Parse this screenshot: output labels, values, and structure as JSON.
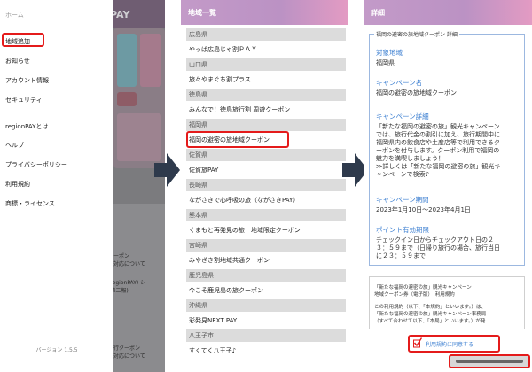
{
  "panel1": {
    "home": "ホーム",
    "menu_top": [
      "地域追加",
      "お知らせ",
      "アカウント情報",
      "セキュリティ"
    ],
    "menu_bottom": [
      "regionPAYとは",
      "ヘルプ",
      "プライバシーポリシー",
      "利用規約",
      "商標・ライセンス"
    ],
    "version": "バージョン 1.5.5",
    "bg_header": "PAY",
    "bg_lines": [
      "クーポン",
      "の対応について",
      "(regionPAY) シ",
      "(第二報)",
      "旅行クーポン",
      "の対応について"
    ]
  },
  "panel2": {
    "title": "地域一覧",
    "rows": [
      {
        "text": "広島県",
        "kind": "pref"
      },
      {
        "text": "やっぱ広島じゃ割ＰＡＹ",
        "kind": "city"
      },
      {
        "text": "山口県",
        "kind": "pref"
      },
      {
        "text": "旅々やまぐち割プラス",
        "kind": "city"
      },
      {
        "text": "徳島県",
        "kind": "pref"
      },
      {
        "text": "みんなで！徳島旅行割 周遊クーポン",
        "kind": "city"
      },
      {
        "text": "福岡県",
        "kind": "pref"
      },
      {
        "text": "福岡の避密の旅地域クーポン",
        "kind": "city"
      },
      {
        "text": "佐賀県",
        "kind": "pref"
      },
      {
        "text": "佐賀旅PAY",
        "kind": "city"
      },
      {
        "text": "長崎県",
        "kind": "pref"
      },
      {
        "text": "ながさきで心呼吸の旅（ながさきPAY）",
        "kind": "city"
      },
      {
        "text": "熊本県",
        "kind": "pref"
      },
      {
        "text": "くまもと再発見の旅　地域限定クーポン",
        "kind": "city"
      },
      {
        "text": "宮崎県",
        "kind": "pref"
      },
      {
        "text": "みやざき割地域共通クーポン",
        "kind": "city"
      },
      {
        "text": "鹿児島県",
        "kind": "pref"
      },
      {
        "text": "今こそ鹿児島の旅クーポン",
        "kind": "city"
      },
      {
        "text": "沖縄県",
        "kind": "pref"
      },
      {
        "text": "彩発見NEXT PAY",
        "kind": "city"
      },
      {
        "text": "八王子市",
        "kind": "pref"
      },
      {
        "text": "すくてく八王子♪",
        "kind": "city"
      }
    ]
  },
  "panel3": {
    "title": "詳細",
    "box_title": "福岡の避密の旅地域クーポン 詳細",
    "target_label": "対象地域",
    "target_value": "福岡県",
    "campaign_label": "キャンペーン名",
    "campaign_value": "福岡の避密の旅地域クーポン",
    "detail_label": "キャンペーン詳細",
    "detail_lines": [
      "「新たな福岡の避密の旅」観光キャンペーン",
      "では、旅行代金の割引に加え、旅行期間中に",
      "福岡県内の飲食店や土産店等で利用できるク",
      "ーポンを付与します。クーポン利用で福岡の",
      "魅力を満喫しましょう！",
      "≫詳しくは「新たな福岡の避密の旅」観光キ",
      "ャンペーンで検索♪"
    ],
    "period_label": "キャンペーン期間",
    "period_value": "2023年1月10日〜2023年4月1日",
    "expiry_label": "ポイント有効期限",
    "expiry_lines": [
      "チェックイン日からチェックアウト日の２",
      "３：５９まで（日帰り旅行の場合、旅行当日",
      "に２３：５９まで"
    ],
    "terms_lines": [
      "「新たな福岡の避密の旅」観光キャンペーン",
      "地域クーポン券（電子版）　利用規約",
      "この利用規約（以下、「本規約」といいます。）は、",
      "「新たな福岡の避密の旅」観光キャンペーン事務局",
      "（すべて合わせて以下、「本局」といいます。）が発"
    ],
    "agree_label": "利用規約に同意する"
  },
  "colors": {
    "header_accent": "#c39ac8",
    "highlight": "#e41b1b",
    "link_blue": "#3c7fd1",
    "arrow": "#2e3a4c"
  }
}
